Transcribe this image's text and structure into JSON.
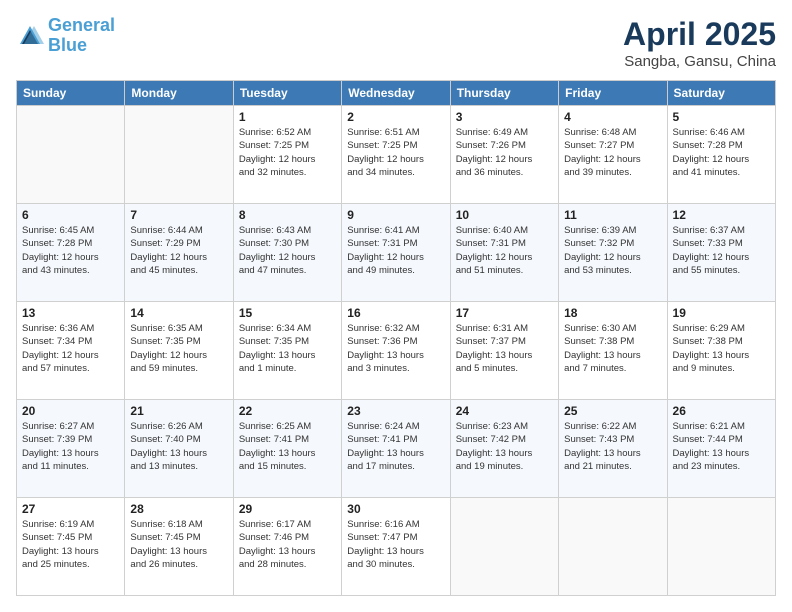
{
  "header": {
    "logo_line1": "General",
    "logo_line2": "Blue",
    "main_title": "April 2025",
    "sub_title": "Sangba, Gansu, China"
  },
  "weekdays": [
    "Sunday",
    "Monday",
    "Tuesday",
    "Wednesday",
    "Thursday",
    "Friday",
    "Saturday"
  ],
  "weeks": [
    [
      {
        "day": "",
        "info": ""
      },
      {
        "day": "",
        "info": ""
      },
      {
        "day": "1",
        "info": "Sunrise: 6:52 AM\nSunset: 7:25 PM\nDaylight: 12 hours\nand 32 minutes."
      },
      {
        "day": "2",
        "info": "Sunrise: 6:51 AM\nSunset: 7:25 PM\nDaylight: 12 hours\nand 34 minutes."
      },
      {
        "day": "3",
        "info": "Sunrise: 6:49 AM\nSunset: 7:26 PM\nDaylight: 12 hours\nand 36 minutes."
      },
      {
        "day": "4",
        "info": "Sunrise: 6:48 AM\nSunset: 7:27 PM\nDaylight: 12 hours\nand 39 minutes."
      },
      {
        "day": "5",
        "info": "Sunrise: 6:46 AM\nSunset: 7:28 PM\nDaylight: 12 hours\nand 41 minutes."
      }
    ],
    [
      {
        "day": "6",
        "info": "Sunrise: 6:45 AM\nSunset: 7:28 PM\nDaylight: 12 hours\nand 43 minutes."
      },
      {
        "day": "7",
        "info": "Sunrise: 6:44 AM\nSunset: 7:29 PM\nDaylight: 12 hours\nand 45 minutes."
      },
      {
        "day": "8",
        "info": "Sunrise: 6:43 AM\nSunset: 7:30 PM\nDaylight: 12 hours\nand 47 minutes."
      },
      {
        "day": "9",
        "info": "Sunrise: 6:41 AM\nSunset: 7:31 PM\nDaylight: 12 hours\nand 49 minutes."
      },
      {
        "day": "10",
        "info": "Sunrise: 6:40 AM\nSunset: 7:31 PM\nDaylight: 12 hours\nand 51 minutes."
      },
      {
        "day": "11",
        "info": "Sunrise: 6:39 AM\nSunset: 7:32 PM\nDaylight: 12 hours\nand 53 minutes."
      },
      {
        "day": "12",
        "info": "Sunrise: 6:37 AM\nSunset: 7:33 PM\nDaylight: 12 hours\nand 55 minutes."
      }
    ],
    [
      {
        "day": "13",
        "info": "Sunrise: 6:36 AM\nSunset: 7:34 PM\nDaylight: 12 hours\nand 57 minutes."
      },
      {
        "day": "14",
        "info": "Sunrise: 6:35 AM\nSunset: 7:35 PM\nDaylight: 12 hours\nand 59 minutes."
      },
      {
        "day": "15",
        "info": "Sunrise: 6:34 AM\nSunset: 7:35 PM\nDaylight: 13 hours\nand 1 minute."
      },
      {
        "day": "16",
        "info": "Sunrise: 6:32 AM\nSunset: 7:36 PM\nDaylight: 13 hours\nand 3 minutes."
      },
      {
        "day": "17",
        "info": "Sunrise: 6:31 AM\nSunset: 7:37 PM\nDaylight: 13 hours\nand 5 minutes."
      },
      {
        "day": "18",
        "info": "Sunrise: 6:30 AM\nSunset: 7:38 PM\nDaylight: 13 hours\nand 7 minutes."
      },
      {
        "day": "19",
        "info": "Sunrise: 6:29 AM\nSunset: 7:38 PM\nDaylight: 13 hours\nand 9 minutes."
      }
    ],
    [
      {
        "day": "20",
        "info": "Sunrise: 6:27 AM\nSunset: 7:39 PM\nDaylight: 13 hours\nand 11 minutes."
      },
      {
        "day": "21",
        "info": "Sunrise: 6:26 AM\nSunset: 7:40 PM\nDaylight: 13 hours\nand 13 minutes."
      },
      {
        "day": "22",
        "info": "Sunrise: 6:25 AM\nSunset: 7:41 PM\nDaylight: 13 hours\nand 15 minutes."
      },
      {
        "day": "23",
        "info": "Sunrise: 6:24 AM\nSunset: 7:41 PM\nDaylight: 13 hours\nand 17 minutes."
      },
      {
        "day": "24",
        "info": "Sunrise: 6:23 AM\nSunset: 7:42 PM\nDaylight: 13 hours\nand 19 minutes."
      },
      {
        "day": "25",
        "info": "Sunrise: 6:22 AM\nSunset: 7:43 PM\nDaylight: 13 hours\nand 21 minutes."
      },
      {
        "day": "26",
        "info": "Sunrise: 6:21 AM\nSunset: 7:44 PM\nDaylight: 13 hours\nand 23 minutes."
      }
    ],
    [
      {
        "day": "27",
        "info": "Sunrise: 6:19 AM\nSunset: 7:45 PM\nDaylight: 13 hours\nand 25 minutes."
      },
      {
        "day": "28",
        "info": "Sunrise: 6:18 AM\nSunset: 7:45 PM\nDaylight: 13 hours\nand 26 minutes."
      },
      {
        "day": "29",
        "info": "Sunrise: 6:17 AM\nSunset: 7:46 PM\nDaylight: 13 hours\nand 28 minutes."
      },
      {
        "day": "30",
        "info": "Sunrise: 6:16 AM\nSunset: 7:47 PM\nDaylight: 13 hours\nand 30 minutes."
      },
      {
        "day": "",
        "info": ""
      },
      {
        "day": "",
        "info": ""
      },
      {
        "day": "",
        "info": ""
      }
    ]
  ]
}
